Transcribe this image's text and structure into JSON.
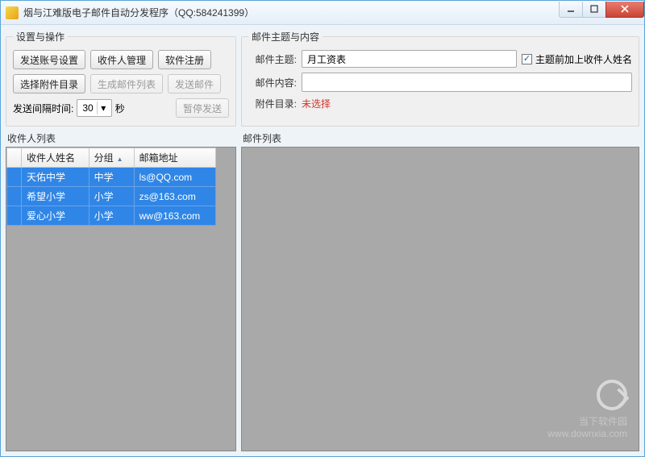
{
  "window": {
    "title": "烟与江难版电子邮件自动分发程序（QQ:584241399）"
  },
  "settings": {
    "legend": "设置与操作",
    "btn_account": "发送账号设置",
    "btn_recipients": "收件人管理",
    "btn_register": "软件注册",
    "btn_choose_dir": "选择附件目录",
    "btn_gen_list": "生成邮件列表",
    "btn_send": "发送邮件",
    "interval_label": "发送间隔时间:",
    "interval_value": "30",
    "interval_unit": "秒",
    "btn_pause": "暂停发送"
  },
  "subject": {
    "legend": "邮件主题与内容",
    "label_subject": "邮件主题:",
    "value_subject": "月工资表",
    "checkbox_label": "主题前加上收件人姓名",
    "checkbox_checked": true,
    "label_body": "邮件内容:",
    "value_body": "",
    "label_dir": "附件目录:",
    "value_dir": "未选择"
  },
  "recipients": {
    "panel_label": "收件人列表",
    "col_name": "收件人姓名",
    "col_group": "分组",
    "col_email": "邮箱地址",
    "rows": [
      {
        "name": "天佑中学",
        "group": "中学",
        "email": "ls@QQ.com"
      },
      {
        "name": "希望小学",
        "group": "小学",
        "email": "zs@163.com"
      },
      {
        "name": "爱心小学",
        "group": "小学",
        "email": "ww@163.com"
      }
    ]
  },
  "maillist": {
    "panel_label": "邮件列表"
  },
  "watermark": {
    "line1": "当下软件园",
    "line2": "www.downxia.com"
  }
}
